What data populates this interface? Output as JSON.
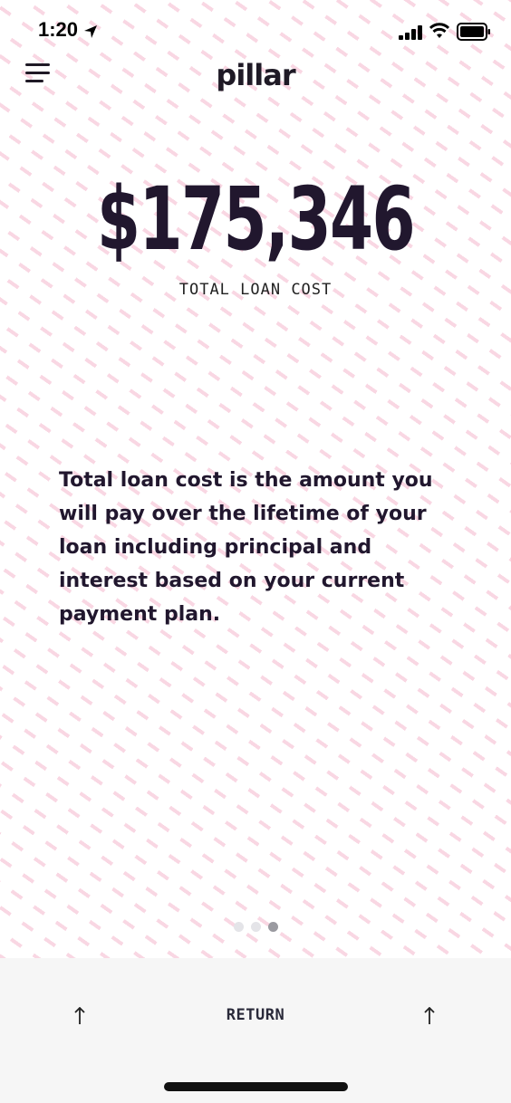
{
  "status_bar": {
    "time": "1:20",
    "icons": [
      "location-arrow-icon",
      "cellular-signal-icon",
      "wifi-icon",
      "battery-icon"
    ]
  },
  "header": {
    "menu_icon": "hamburger-menu-icon",
    "logo": "pillar"
  },
  "main": {
    "amount": "$175,346",
    "amount_label": "TOTAL LOAN COST",
    "description": "Total loan cost is the amount you will pay over the lifetime of your loan including principal and interest based on your current payment plan."
  },
  "pagination": {
    "total": 3,
    "active_index": 2
  },
  "footer": {
    "return_label": "RETURN",
    "left_icon": "arrow-up-icon",
    "right_icon": "arrow-up-icon"
  },
  "colors": {
    "text_dark": "#21172e",
    "pattern_pink": "#f4b6cc",
    "footer_bg": "#f6f6f6",
    "dot_active": "#9a9aa0",
    "dot_inactive": "#e4e4e8"
  }
}
